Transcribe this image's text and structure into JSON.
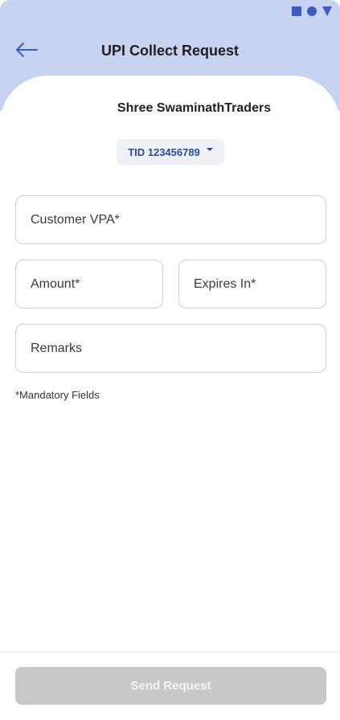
{
  "header": {
    "title": "UPI Collect Request"
  },
  "merchant": {
    "name": "Shree SwaminathTraders",
    "tid_label": "TID 123456789"
  },
  "form": {
    "vpa_placeholder": "Customer VPA*",
    "amount_placeholder": "Amount*",
    "expires_placeholder": "Expires In*",
    "remarks_placeholder": "Remarks",
    "mandatory_note": "*Mandatory Fields"
  },
  "footer": {
    "send_label": "Send Request"
  },
  "icons": {
    "back": "back-arrow-icon",
    "tid_dropdown": "chevron-down-icon",
    "status": [
      "square-icon",
      "circle-icon",
      "triangle-icon"
    ]
  },
  "colors": {
    "header_bg": "#c7d2f0",
    "accent": "#3d5cc2",
    "tid_text": "#2c4a9a",
    "button_disabled": "#c8c8c8"
  }
}
